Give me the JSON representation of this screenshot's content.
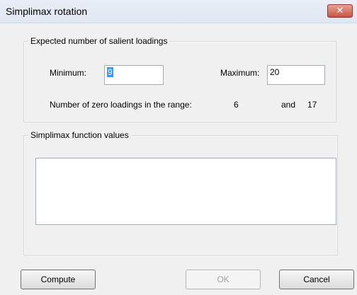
{
  "window": {
    "title": "Simplimax rotation",
    "close_glyph": "✕"
  },
  "salient": {
    "legend": "Expected number of salient loadings",
    "minimum_label": "Minimum:",
    "minimum_value": "9",
    "maximum_label": "Maximum:",
    "maximum_value": "20",
    "zero_range_label": "Number of zero loadings in the range:",
    "zero_min": "6",
    "and_label": "and",
    "zero_max": "17"
  },
  "function_values": {
    "legend": "Simplimax function values",
    "items": []
  },
  "buttons": {
    "compute": "Compute",
    "ok": "OK",
    "cancel": "Cancel"
  },
  "colors": {
    "close_button": "#c8553e",
    "selection": "#3399ff"
  }
}
